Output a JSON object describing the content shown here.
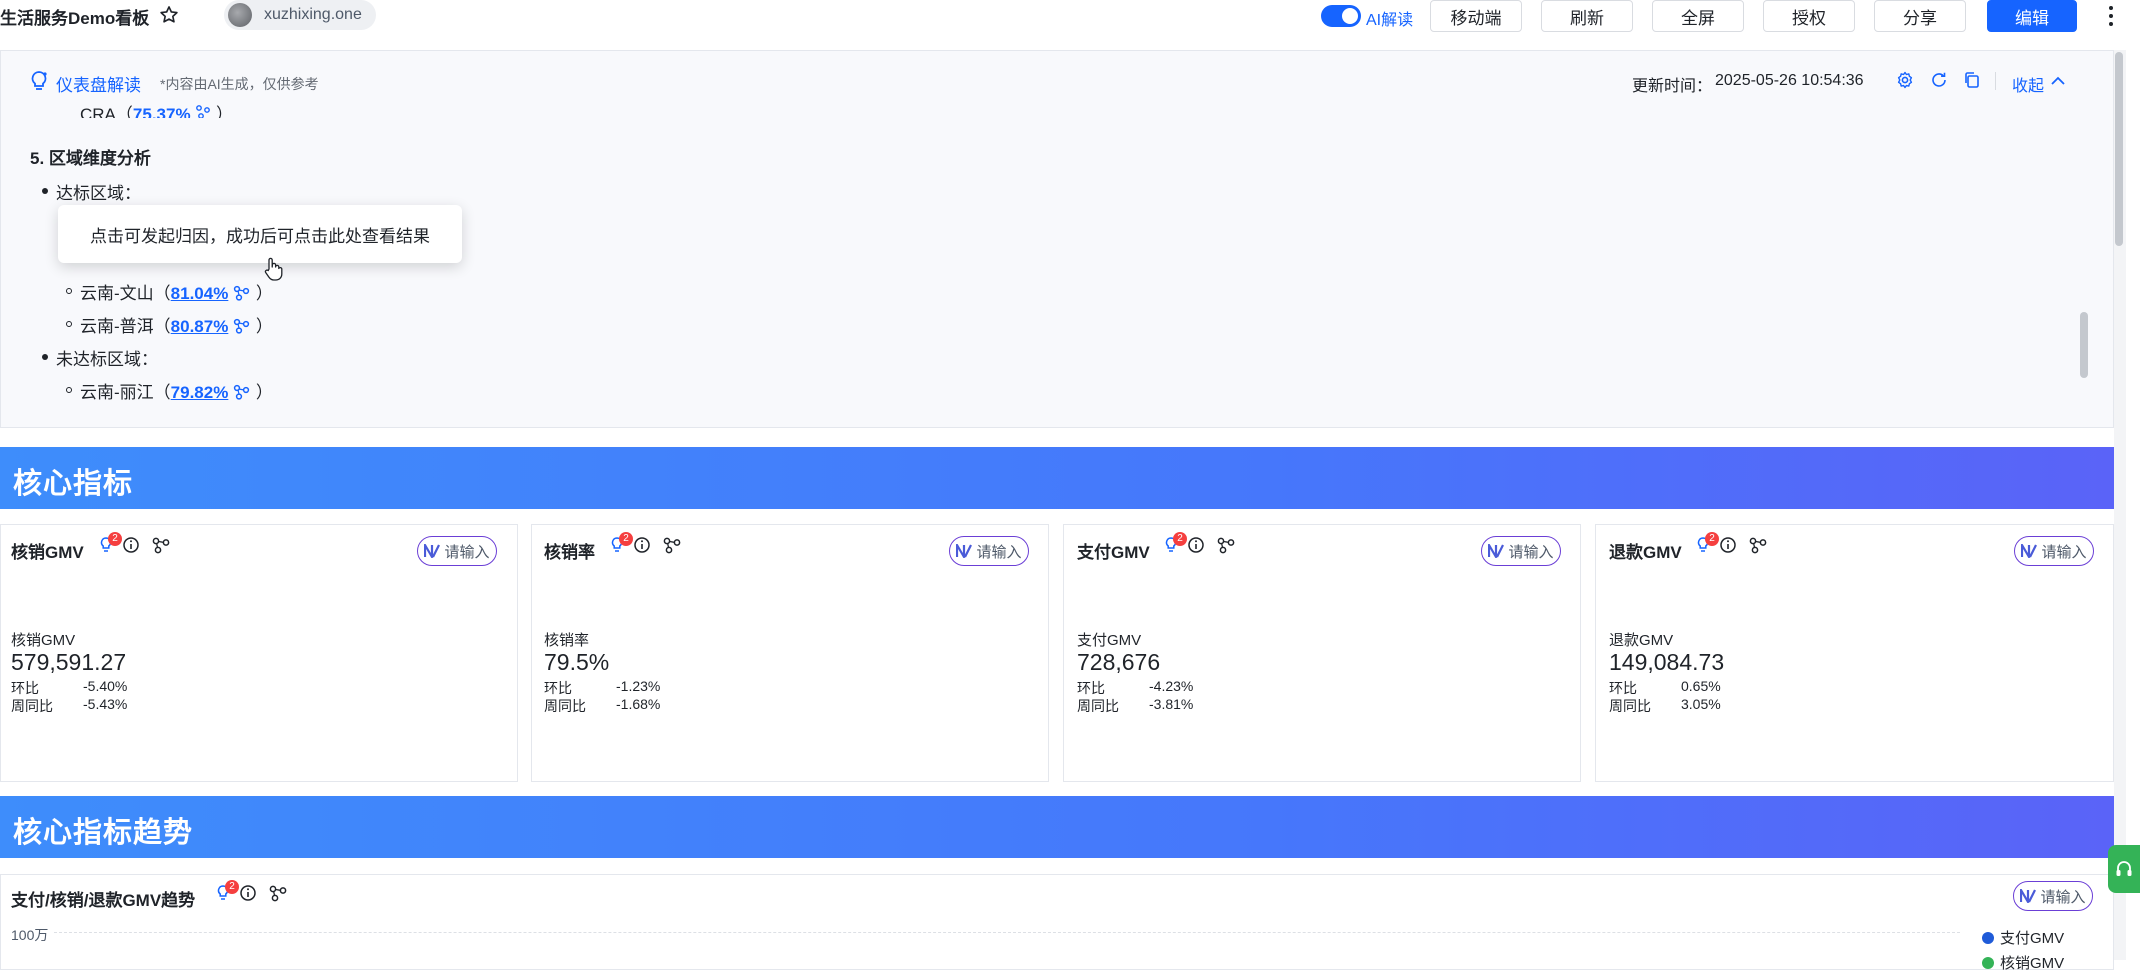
{
  "topbar": {
    "title": "生活服务Demo看板",
    "owner": "xuzhixing.one",
    "ai_toggle_label": "AI解读",
    "buttons": [
      "移动端",
      "刷新",
      "全屏",
      "授权",
      "分享",
      "编辑"
    ]
  },
  "ai_panel": {
    "title": "仪表盘解读",
    "note": "*内容由AI生成，仅供参考",
    "update_label": "更新时间：",
    "update_time": "2025-05-26 10:54:36",
    "collapse_label": "收起",
    "cut_line": "CRA（",
    "cut_pct": "75.37%",
    "cut_end": "）",
    "section_heading": "5. 区域维度分析",
    "groups": [
      {
        "label": "达标区域：",
        "items": [
          {
            "name": "云南-文山（",
            "pct": "81.04%",
            "end": "）"
          },
          {
            "name": "云南-普洱（",
            "pct": "80.87%",
            "end": "）"
          }
        ]
      },
      {
        "label": "未达标区域：",
        "items": [
          {
            "name": "云南-丽江（",
            "pct": "79.82%",
            "end": "）"
          }
        ]
      }
    ],
    "tooltip": "点击可发起归因，成功后可点击此处查看结果"
  },
  "sections": {
    "core": "核心指标",
    "trend": "核心指标趋势"
  },
  "cards": [
    {
      "title": "核销GMV",
      "label": "核销GMV",
      "value": "579,591.27",
      "mom_label": "环比",
      "mom": "-5.40%",
      "wow_label": "周同比",
      "wow": "-5.43%",
      "badge": "2",
      "ask": "请输入"
    },
    {
      "title": "核销率",
      "label": "核销率",
      "value": "79.5%",
      "mom_label": "环比",
      "mom": "-1.23%",
      "wow_label": "周同比",
      "wow": "-1.68%",
      "badge": "2",
      "ask": "请输入"
    },
    {
      "title": "支付GMV",
      "label": "支付GMV",
      "value": "728,676",
      "mom_label": "环比",
      "mom": "-4.23%",
      "wow_label": "周同比",
      "wow": "-3.81%",
      "badge": "2",
      "ask": "请输入"
    },
    {
      "title": "退款GMV",
      "label": "退款GMV",
      "value": "149,084.73",
      "mom_label": "环比",
      "mom": "0.65%",
      "wow_label": "周同比",
      "wow": "3.05%",
      "badge": "2",
      "ask": "请输入"
    }
  ],
  "trend_chart": {
    "title": "支付/核销/退款GMV趋势",
    "badge": "2",
    "ask": "请输入",
    "y_tick": "100万",
    "legend": [
      {
        "name": "支付GMV",
        "color": "#1f5bd8"
      },
      {
        "name": "核销GMV",
        "color": "#34b357"
      }
    ]
  },
  "colors": {
    "accent": "#1664ff",
    "banner_start": "#3e8dfb",
    "banner_end": "#5a63f8",
    "badge": "#f53f3f"
  }
}
